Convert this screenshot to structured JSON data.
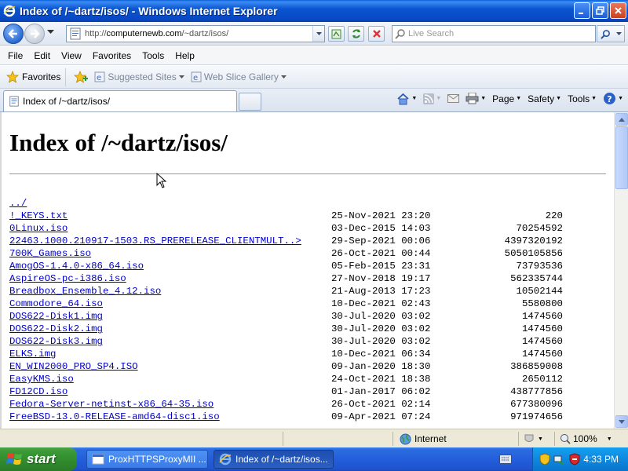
{
  "window": {
    "title": "Index of /~dartz/isos/ - Windows Internet Explorer"
  },
  "address": {
    "url_prefix": "http://",
    "url_host": "computernewb.com",
    "url_path": "/~dartz/isos/",
    "search_placeholder": "Live Search"
  },
  "menu": [
    "File",
    "Edit",
    "View",
    "Favorites",
    "Tools",
    "Help"
  ],
  "favorites": {
    "label": "Favorites",
    "links": [
      "Suggested Sites",
      "Web Slice Gallery"
    ]
  },
  "tab": {
    "label": "Index of /~dartz/isos/"
  },
  "commands": [
    "Page",
    "Safety",
    "Tools"
  ],
  "page": {
    "heading": "Index of /~dartz/isos/",
    "parent_link": "../",
    "files": [
      {
        "name": "!_KEYS.txt",
        "date": "25-Nov-2021 23:20",
        "size": "220"
      },
      {
        "name": "0Linux.iso",
        "date": "03-Dec-2015 14:03",
        "size": "70254592"
      },
      {
        "name": "22463.1000.210917-1503.RS_PRERELEASE_CLIENTMULT..>",
        "date": "29-Sep-2021 00:06",
        "size": "4397320192"
      },
      {
        "name": "700K_Games.iso",
        "date": "26-Oct-2021 00:44",
        "size": "5050105856"
      },
      {
        "name": "AmogOS-1.4.0-x86_64.iso",
        "date": "05-Feb-2015 23:31",
        "size": "73793536"
      },
      {
        "name": "AspireOS-pc-i386.iso",
        "date": "27-Nov-2018 19:17",
        "size": "562335744"
      },
      {
        "name": "Breadbox_Ensemble_4.12.iso",
        "date": "21-Aug-2013 17:23",
        "size": "10502144"
      },
      {
        "name": "Commodore_64.iso",
        "date": "10-Dec-2021 02:43",
        "size": "5580800"
      },
      {
        "name": "DOS622-Disk1.img",
        "date": "30-Jul-2020 03:02",
        "size": "1474560"
      },
      {
        "name": "DOS622-Disk2.img",
        "date": "30-Jul-2020 03:02",
        "size": "1474560"
      },
      {
        "name": "DOS622-Disk3.img",
        "date": "30-Jul-2020 03:02",
        "size": "1474560"
      },
      {
        "name": "ELKS.img",
        "date": "10-Dec-2021 06:34",
        "size": "1474560"
      },
      {
        "name": "EN_WIN2000_PRO_SP4.ISO",
        "date": "09-Jan-2020 18:30",
        "size": "386859008"
      },
      {
        "name": "EasyKMS.iso",
        "date": "24-Oct-2021 18:38",
        "size": "2650112"
      },
      {
        "name": "FD12CD.iso",
        "date": "01-Jan-2017 06:02",
        "size": "438777856"
      },
      {
        "name": "Fedora-Server-netinst-x86_64-35.iso",
        "date": "26-Oct-2021 02:14",
        "size": "677380096"
      },
      {
        "name": "FreeBSD-13.0-RELEASE-amd64-disc1.iso",
        "date": "09-Apr-2021 07:24",
        "size": "971974656"
      }
    ]
  },
  "status": {
    "zone": "Internet",
    "zoom": "100%"
  },
  "taskbar": {
    "start_label": "start",
    "tasks": [
      "ProxHTTPSProxyMII ...",
      "Index of /~dartz/isos..."
    ],
    "clock": "4:33 PM"
  },
  "colors": {
    "link": "#0000cc",
    "titlebar": "#0a55d0",
    "taskbar": "#245edb",
    "start": "#3c9a38"
  }
}
